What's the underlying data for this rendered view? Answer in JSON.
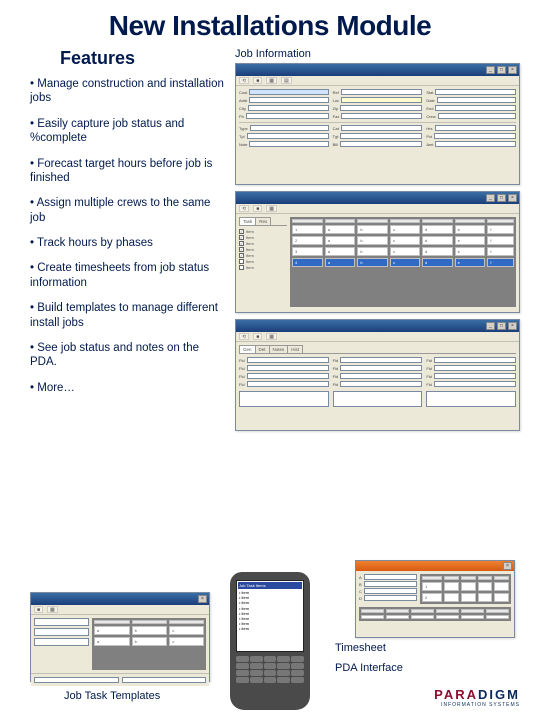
{
  "title": "New Installations Module",
  "features_heading": "Features",
  "features": [
    " Manage  construction and installation jobs",
    "Easily capture job status and %complete",
    "Forecast target hours before job is finished",
    "Assign multiple crews to the same job",
    "Track hours by phases",
    "Create timesheets from job status information",
    "Build templates to manage different install jobs",
    "See job status and notes on the PDA.",
    "More…"
  ],
  "labels": {
    "job_info": "Job Information",
    "timesheet": "Timesheet",
    "pda_interface": "PDA Interface",
    "job_task_templates": "Job Task Templates"
  },
  "logo": {
    "brand_a": "PARA",
    "brand_b": "DIGM",
    "tagline": "INFORMATION SYSTEMS"
  },
  "pda": {
    "header": "Job Task Items"
  }
}
